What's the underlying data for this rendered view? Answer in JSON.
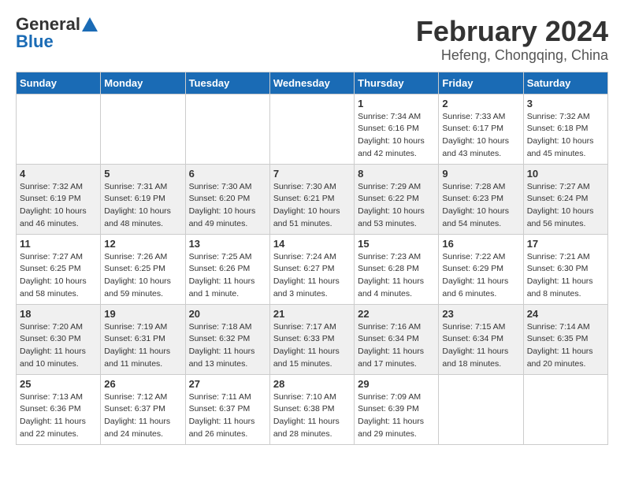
{
  "header": {
    "logo_general": "General",
    "logo_blue": "Blue",
    "title": "February 2024",
    "subtitle": "Hefeng, Chongqing, China"
  },
  "calendar": {
    "days_of_week": [
      "Sunday",
      "Monday",
      "Tuesday",
      "Wednesday",
      "Thursday",
      "Friday",
      "Saturday"
    ],
    "weeks": [
      [
        {
          "day": "",
          "info": ""
        },
        {
          "day": "",
          "info": ""
        },
        {
          "day": "",
          "info": ""
        },
        {
          "day": "",
          "info": ""
        },
        {
          "day": "1",
          "info": "Sunrise: 7:34 AM\nSunset: 6:16 PM\nDaylight: 10 hours\nand 42 minutes."
        },
        {
          "day": "2",
          "info": "Sunrise: 7:33 AM\nSunset: 6:17 PM\nDaylight: 10 hours\nand 43 minutes."
        },
        {
          "day": "3",
          "info": "Sunrise: 7:32 AM\nSunset: 6:18 PM\nDaylight: 10 hours\nand 45 minutes."
        }
      ],
      [
        {
          "day": "4",
          "info": "Sunrise: 7:32 AM\nSunset: 6:19 PM\nDaylight: 10 hours\nand 46 minutes."
        },
        {
          "day": "5",
          "info": "Sunrise: 7:31 AM\nSunset: 6:19 PM\nDaylight: 10 hours\nand 48 minutes."
        },
        {
          "day": "6",
          "info": "Sunrise: 7:30 AM\nSunset: 6:20 PM\nDaylight: 10 hours\nand 49 minutes."
        },
        {
          "day": "7",
          "info": "Sunrise: 7:30 AM\nSunset: 6:21 PM\nDaylight: 10 hours\nand 51 minutes."
        },
        {
          "day": "8",
          "info": "Sunrise: 7:29 AM\nSunset: 6:22 PM\nDaylight: 10 hours\nand 53 minutes."
        },
        {
          "day": "9",
          "info": "Sunrise: 7:28 AM\nSunset: 6:23 PM\nDaylight: 10 hours\nand 54 minutes."
        },
        {
          "day": "10",
          "info": "Sunrise: 7:27 AM\nSunset: 6:24 PM\nDaylight: 10 hours\nand 56 minutes."
        }
      ],
      [
        {
          "day": "11",
          "info": "Sunrise: 7:27 AM\nSunset: 6:25 PM\nDaylight: 10 hours\nand 58 minutes."
        },
        {
          "day": "12",
          "info": "Sunrise: 7:26 AM\nSunset: 6:25 PM\nDaylight: 10 hours\nand 59 minutes."
        },
        {
          "day": "13",
          "info": "Sunrise: 7:25 AM\nSunset: 6:26 PM\nDaylight: 11 hours\nand 1 minute."
        },
        {
          "day": "14",
          "info": "Sunrise: 7:24 AM\nSunset: 6:27 PM\nDaylight: 11 hours\nand 3 minutes."
        },
        {
          "day": "15",
          "info": "Sunrise: 7:23 AM\nSunset: 6:28 PM\nDaylight: 11 hours\nand 4 minutes."
        },
        {
          "day": "16",
          "info": "Sunrise: 7:22 AM\nSunset: 6:29 PM\nDaylight: 11 hours\nand 6 minutes."
        },
        {
          "day": "17",
          "info": "Sunrise: 7:21 AM\nSunset: 6:30 PM\nDaylight: 11 hours\nand 8 minutes."
        }
      ],
      [
        {
          "day": "18",
          "info": "Sunrise: 7:20 AM\nSunset: 6:30 PM\nDaylight: 11 hours\nand 10 minutes."
        },
        {
          "day": "19",
          "info": "Sunrise: 7:19 AM\nSunset: 6:31 PM\nDaylight: 11 hours\nand 11 minutes."
        },
        {
          "day": "20",
          "info": "Sunrise: 7:18 AM\nSunset: 6:32 PM\nDaylight: 11 hours\nand 13 minutes."
        },
        {
          "day": "21",
          "info": "Sunrise: 7:17 AM\nSunset: 6:33 PM\nDaylight: 11 hours\nand 15 minutes."
        },
        {
          "day": "22",
          "info": "Sunrise: 7:16 AM\nSunset: 6:34 PM\nDaylight: 11 hours\nand 17 minutes."
        },
        {
          "day": "23",
          "info": "Sunrise: 7:15 AM\nSunset: 6:34 PM\nDaylight: 11 hours\nand 18 minutes."
        },
        {
          "day": "24",
          "info": "Sunrise: 7:14 AM\nSunset: 6:35 PM\nDaylight: 11 hours\nand 20 minutes."
        }
      ],
      [
        {
          "day": "25",
          "info": "Sunrise: 7:13 AM\nSunset: 6:36 PM\nDaylight: 11 hours\nand 22 minutes."
        },
        {
          "day": "26",
          "info": "Sunrise: 7:12 AM\nSunset: 6:37 PM\nDaylight: 11 hours\nand 24 minutes."
        },
        {
          "day": "27",
          "info": "Sunrise: 7:11 AM\nSunset: 6:37 PM\nDaylight: 11 hours\nand 26 minutes."
        },
        {
          "day": "28",
          "info": "Sunrise: 7:10 AM\nSunset: 6:38 PM\nDaylight: 11 hours\nand 28 minutes."
        },
        {
          "day": "29",
          "info": "Sunrise: 7:09 AM\nSunset: 6:39 PM\nDaylight: 11 hours\nand 29 minutes."
        },
        {
          "day": "",
          "info": ""
        },
        {
          "day": "",
          "info": ""
        }
      ]
    ]
  }
}
